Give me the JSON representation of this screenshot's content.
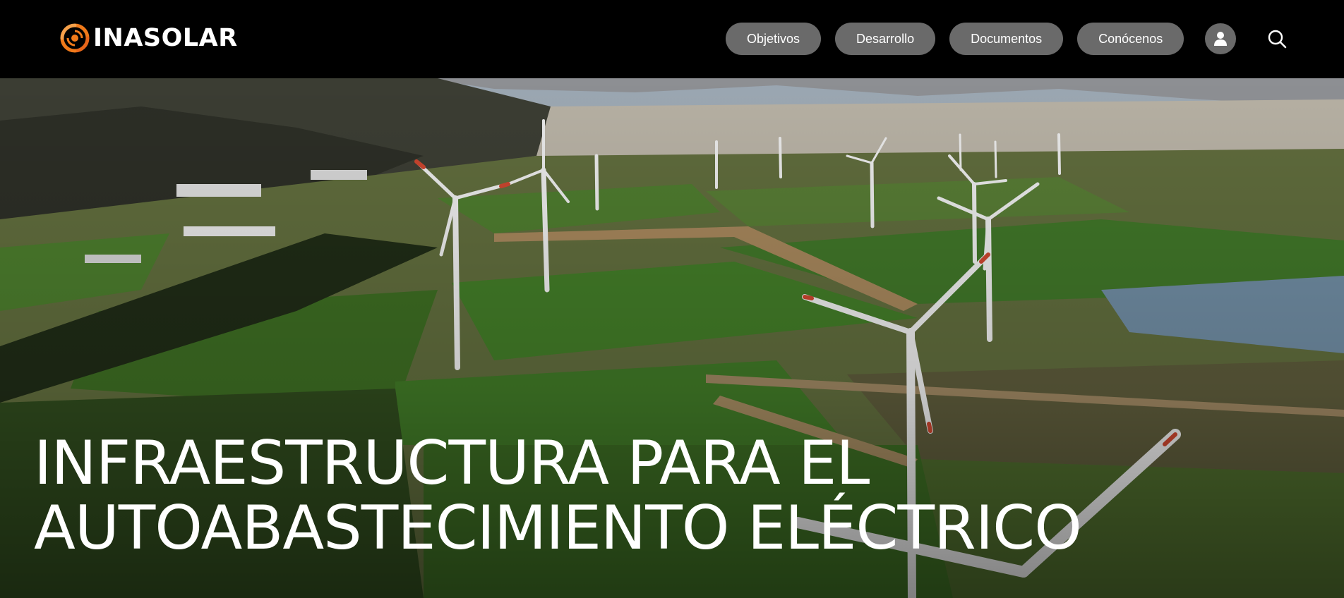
{
  "brand": {
    "name": "INASOLAR",
    "accent": "#f07a1a"
  },
  "nav": {
    "items": [
      {
        "label": "Objetivos"
      },
      {
        "label": "Desarrollo"
      },
      {
        "label": "Documentos"
      },
      {
        "label": "Conócenos"
      }
    ],
    "pill_color": "#6a6a6a"
  },
  "icons": {
    "user": "user-icon",
    "search": "search-icon"
  },
  "hero": {
    "title_line1": "INFRAESTRUCTURA PARA EL",
    "title_line2": "AUTOABASTECIMIENTO ELÉCTRICO"
  }
}
